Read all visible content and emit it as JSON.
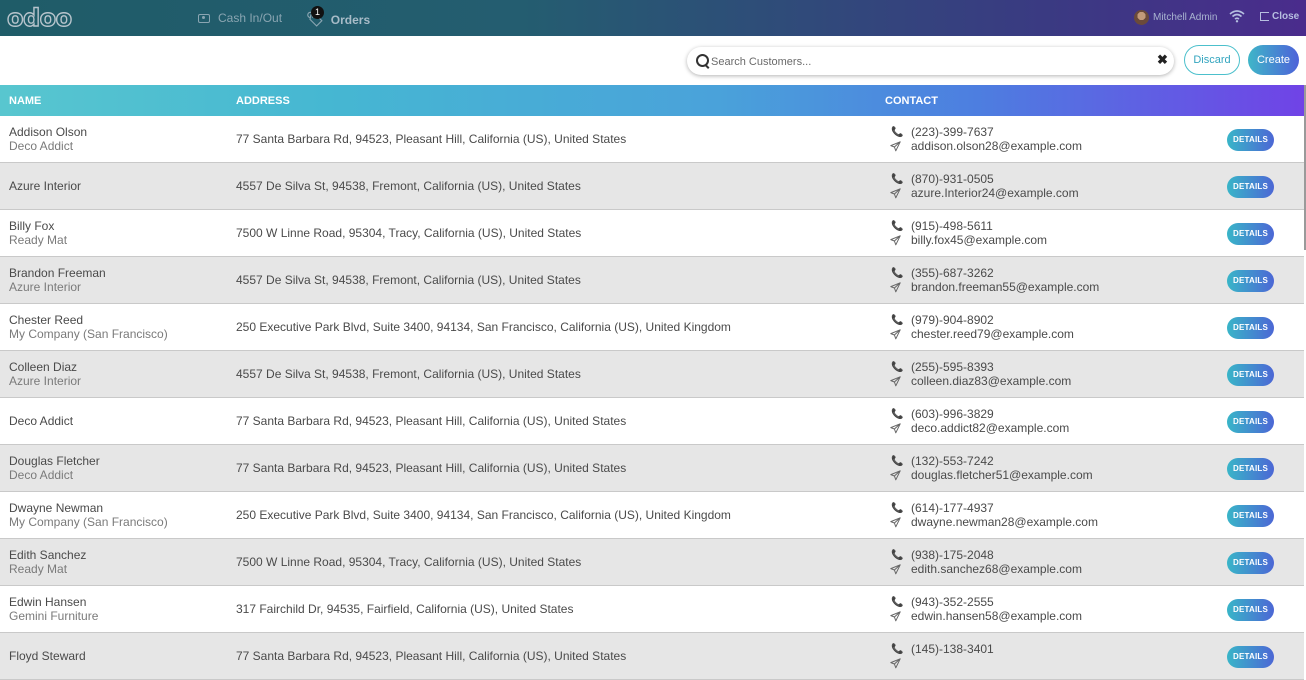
{
  "navbar": {
    "logo": "odoo",
    "cash_label": "Cash In/Out",
    "orders_label": "Orders",
    "orders_badge": "1",
    "user_name": "Mitchell Admin",
    "close_label": "Close"
  },
  "controls": {
    "search_placeholder": "Search Customers...",
    "clear_glyph": "✖",
    "discard_label": "Discard",
    "create_label": "Create"
  },
  "table": {
    "headers": {
      "name": "NAME",
      "address": "ADDRESS",
      "contact": "CONTACT"
    },
    "details_label": "DETAILS",
    "rows": [
      {
        "name": "Addison Olson",
        "company": "Deco Addict",
        "address": "77 Santa Barbara Rd, 94523, Pleasant Hill, California (US), United States",
        "phone": "(223)-399-7637",
        "email": "addison.olson28@example.com"
      },
      {
        "name": "Azure Interior",
        "company": "",
        "address": "4557 De Silva St, 94538, Fremont, California (US), United States",
        "phone": "(870)-931-0505",
        "email": "azure.Interior24@example.com"
      },
      {
        "name": "Billy Fox",
        "company": "Ready Mat",
        "address": "7500 W Linne Road, 95304, Tracy, California (US), United States",
        "phone": "(915)-498-5611",
        "email": "billy.fox45@example.com"
      },
      {
        "name": "Brandon Freeman",
        "company": "Azure Interior",
        "address": "4557 De Silva St, 94538, Fremont, California (US), United States",
        "phone": "(355)-687-3262",
        "email": "brandon.freeman55@example.com"
      },
      {
        "name": "Chester Reed",
        "company": "My Company (San Francisco)",
        "address": "250 Executive Park Blvd, Suite 3400, 94134, San Francisco, California (US), United Kingdom",
        "phone": "(979)-904-8902",
        "email": "chester.reed79@example.com"
      },
      {
        "name": "Colleen Diaz",
        "company": "Azure Interior",
        "address": "4557 De Silva St, 94538, Fremont, California (US), United States",
        "phone": "(255)-595-8393",
        "email": "colleen.diaz83@example.com"
      },
      {
        "name": "Deco Addict",
        "company": "",
        "address": "77 Santa Barbara Rd, 94523, Pleasant Hill, California (US), United States",
        "phone": "(603)-996-3829",
        "email": "deco.addict82@example.com"
      },
      {
        "name": "Douglas Fletcher",
        "company": "Deco Addict",
        "address": "77 Santa Barbara Rd, 94523, Pleasant Hill, California (US), United States",
        "phone": "(132)-553-7242",
        "email": "douglas.fletcher51@example.com"
      },
      {
        "name": "Dwayne Newman",
        "company": "My Company (San Francisco)",
        "address": "250 Executive Park Blvd, Suite 3400, 94134, San Francisco, California (US), United Kingdom",
        "phone": "(614)-177-4937",
        "email": "dwayne.newman28@example.com"
      },
      {
        "name": "Edith Sanchez",
        "company": "Ready Mat",
        "address": "7500 W Linne Road, 95304, Tracy, California (US), United States",
        "phone": "(938)-175-2048",
        "email": "edith.sanchez68@example.com"
      },
      {
        "name": "Edwin Hansen",
        "company": "Gemini Furniture",
        "address": "317 Fairchild Dr, 94535, Fairfield, California (US), United States",
        "phone": "(943)-352-2555",
        "email": "edwin.hansen58@example.com"
      },
      {
        "name": "Floyd Steward",
        "company": "",
        "address": "77 Santa Barbara Rd, 94523, Pleasant Hill, California (US), United States",
        "phone": "(145)-138-3401",
        "email": ""
      }
    ]
  }
}
